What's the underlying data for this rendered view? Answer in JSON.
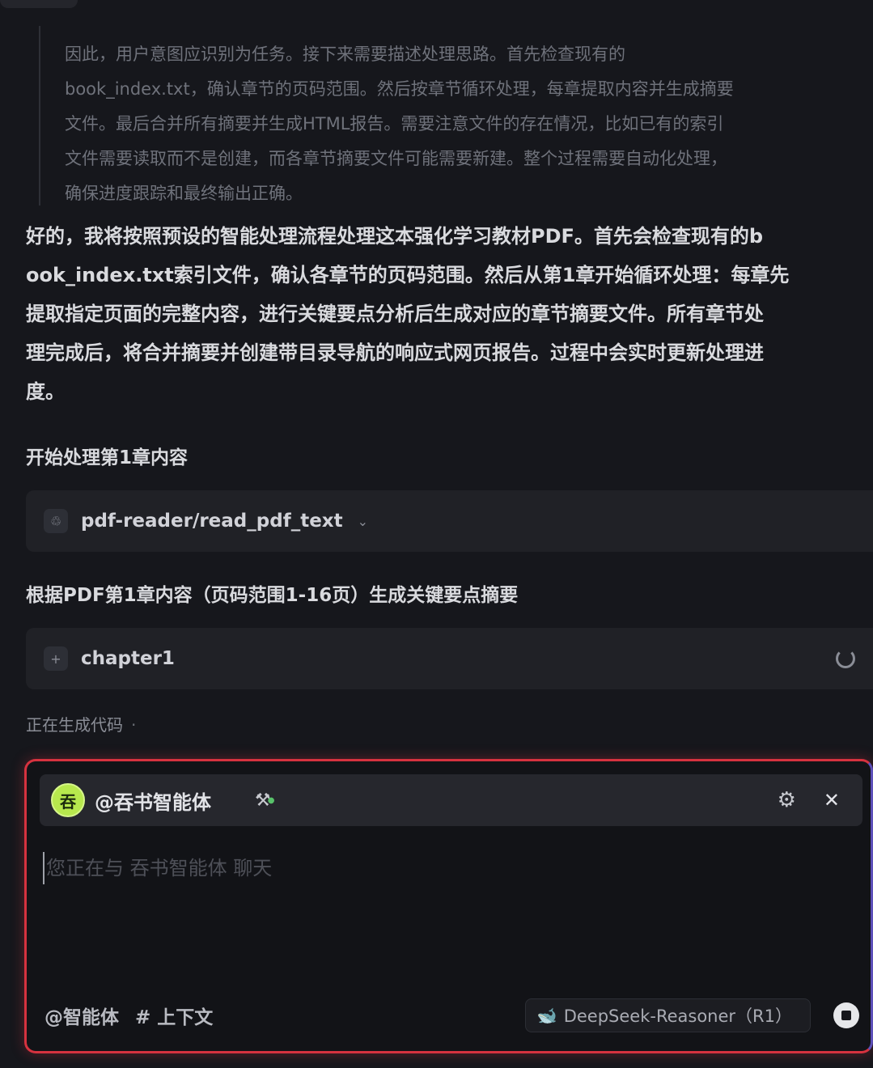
{
  "thinking": {
    "lines": [
      "因此，用户意图应识别为任务。接下来需要描述处理思路。首先检查现有的",
      "book_index.txt，确认章节的页码范围。然后按章节循环处理，每章提取内容并生成摘要",
      "文件。最后合并所有摘要并生成HTML报告。需要注意文件的存在情况，比如已有的索引",
      "文件需要读取而不是创建，而各章节摘要文件可能需要新建。整个过程需要自动化处理，",
      "确保进度跟踪和最终输出正确。"
    ]
  },
  "answer": {
    "lines": [
      "好的，我将按照预设的智能处理流程处理这本强化学习教材PDF。首先会检查现有的b",
      "ook_index.txt索引文件，确认各章节的页码范围。然后从第1章开始循环处理：每章先",
      "提取指定页面的完整内容，进行关键要点分析后生成对应的章节摘要文件。所有章节处",
      "理完成后，将合并摘要并创建带目录导航的响应式网页报告。过程中会实时更新处理进",
      "度。"
    ]
  },
  "steps": [
    {
      "label": "开始处理第1章内容",
      "tool": "pdf-reader/read_pdf_text",
      "tool_icon": "♲",
      "status": "done"
    },
    {
      "label": "根据PDF第1章内容（页码范围1-16页）生成关键要点摘要",
      "tool": "chapter1",
      "tool_icon": "+",
      "status": "running"
    }
  ],
  "generating": {
    "text": "正在生成代码",
    "dot": "·"
  },
  "composer": {
    "agent_avatar": "吞",
    "agent_name": "@吞书智能体",
    "placeholder": "您正在与 吞书智能体 聊天",
    "value": "",
    "mention_agent": "@智能体",
    "mention_context": "# 上下文",
    "model": "DeepSeek-Reasoner（R1）"
  },
  "colors": {
    "accent_border": "#d6323f",
    "avatar": "#b7e84d",
    "background": "#16171c"
  }
}
